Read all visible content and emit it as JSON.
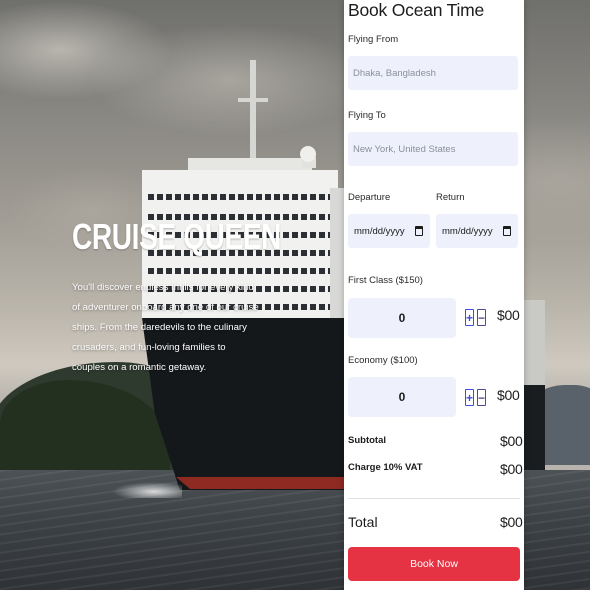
{
  "hero": {
    "title": "CRUISE QUEEN",
    "description": "You'll discover endless thrills for every kind of adventurer onboard any one of our cruise ships. From the daredevils to the culinary crusaders, and fun-loving families to couples on a romantic getaway."
  },
  "booking": {
    "title": "Book Ocean Time",
    "flying_from": {
      "label": "Flying From",
      "placeholder": "Dhaka, Bangladesh"
    },
    "flying_to": {
      "label": "Flying To",
      "placeholder": "New York, United States"
    },
    "departure": {
      "label": "Departure",
      "placeholder": "mm/dd/yyyy"
    },
    "return": {
      "label": "Return",
      "placeholder": "mm/dd/yyyy"
    },
    "first_class": {
      "label": "First Class ($150)",
      "quantity": "0",
      "price": "$00"
    },
    "economy": {
      "label": "Economy ($100)",
      "quantity": "0",
      "price": "$00"
    },
    "subtotal": {
      "label": "Subtotal",
      "value": "$00"
    },
    "vat": {
      "label": "Charge 10% VAT",
      "value": "$00"
    },
    "total": {
      "label": "Total",
      "value": "$00"
    },
    "book_button": "Book Now",
    "plus_symbol": "+",
    "minus_symbol": "−"
  },
  "colors": {
    "accent": "#e63344",
    "field_bg": "#eef1fb",
    "stepper": "#3e4fd6"
  },
  "icons": [
    "calendar-icon",
    "plus-icon",
    "minus-icon"
  ]
}
